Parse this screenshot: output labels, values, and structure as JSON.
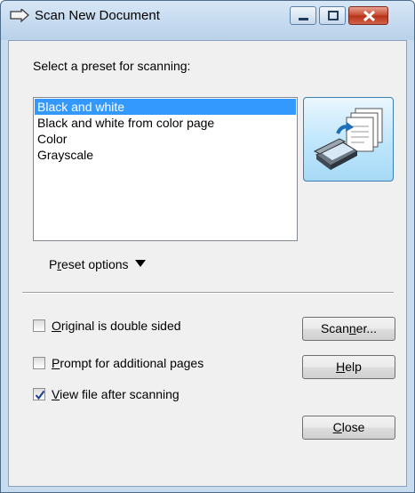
{
  "window": {
    "title": "Scan New Document"
  },
  "dialog": {
    "preset_prompt": "Select a preset for scanning:",
    "presets": [
      {
        "label": "Black and white",
        "selected": true
      },
      {
        "label": "Black and white from color page",
        "selected": false
      },
      {
        "label": "Color",
        "selected": false
      },
      {
        "label": "Grayscale",
        "selected": false
      }
    ],
    "preset_options": {
      "prefix": "P",
      "accel": "r",
      "rest": "eset options"
    },
    "options": [
      {
        "accel": "O",
        "rest": "riginal is double sided",
        "checked": false
      },
      {
        "accel": "P",
        "rest": "rompt for additional pages",
        "checked": false
      },
      {
        "accel": "V",
        "rest": "iew file after scanning",
        "checked": true
      }
    ],
    "buttons": {
      "scanner": {
        "prefix": "Scan",
        "accel": "n",
        "rest": "er..."
      },
      "help": {
        "prefix": "",
        "accel": "H",
        "rest": "elp"
      },
      "close": {
        "prefix": "",
        "accel": "C",
        "rest": "lose"
      }
    }
  },
  "colors": {
    "selection": "#3399ff",
    "title_bar": "#c7dcef",
    "close_button": "#c5462c"
  },
  "icons": {
    "app": "scanner-arrow-icon",
    "scan": "scanner-with-documents-icon",
    "preset_dropdown": "triangle-down-icon"
  }
}
